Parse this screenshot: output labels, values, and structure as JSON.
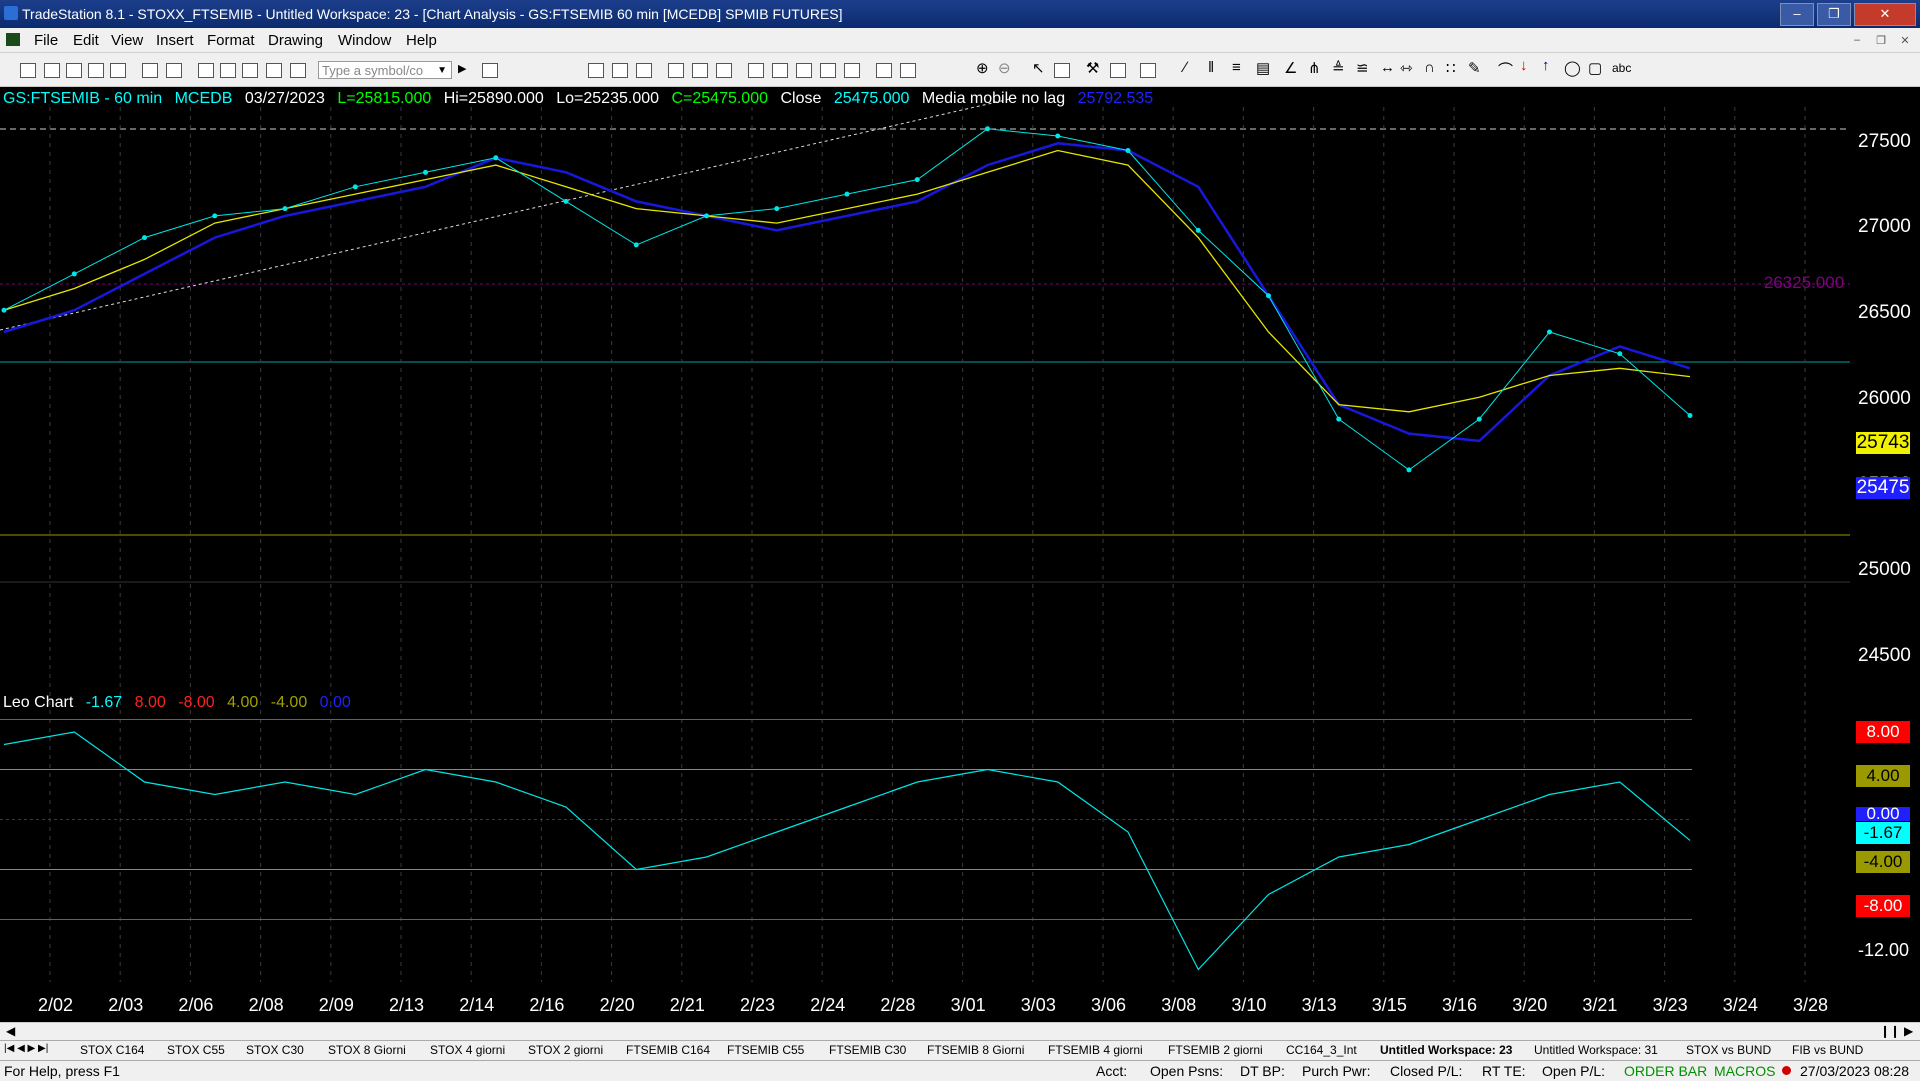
{
  "window": {
    "title": "TradeStation 8.1 - STOXX_FTSEMIB - Untitled Workspace:  23 - [Chart Analysis - GS:FTSEMIB  60 min  [MCEDB] SPMIB FUTURES]"
  },
  "menu": [
    "File",
    "Edit",
    "View",
    "Insert",
    "Format",
    "Drawing",
    "Window",
    "Help"
  ],
  "symbol_input": {
    "placeholder": "Type a symbol/co"
  },
  "chart_header": {
    "symbol": "GS:FTSEMIB - 60 min",
    "exchange": "MCEDB",
    "date": "03/27/2023",
    "last": "L=25815.000",
    "high": "Hi=25890.000",
    "low": "Lo=25235.000",
    "close_eq": "C=25475.000",
    "close_label": "Close",
    "close_value": "25475.000",
    "ma_name": "Media mobile no lag",
    "ma_value": "25792.535"
  },
  "indicator_header": {
    "name": "Leo Chart",
    "values": [
      "-1.67",
      "8.00",
      "-8.00",
      "4.00",
      "-4.00",
      "0.00"
    ],
    "colors": [
      "#00ffff",
      "#ff2020",
      "#ff2020",
      "#a0a000",
      "#a0a000",
      "#2020ff"
    ]
  },
  "colors": {
    "price": "#00e6e6",
    "blue_ma": "#1818dd",
    "yellow_ma": "#e6e600",
    "level_line": "#800080",
    "upper": "#ff2020",
    "mid": "#9a9a00",
    "zero": "#2020ff"
  },
  "price_axis": [
    "27500",
    "27000",
    "26500",
    "26000",
    "25500",
    "25000",
    "24500"
  ],
  "price_boxes": [
    {
      "value": "26325.000",
      "kind": "level"
    },
    {
      "value": "25743",
      "kind": "yellow"
    },
    {
      "value": "25475",
      "kind": "blue"
    }
  ],
  "indicator_axis": [
    "8.00",
    "4.00",
    "0.00",
    "-1.67",
    "-4.00",
    "-8.00",
    "-12.00"
  ],
  "dates": [
    "2/02",
    "2/03",
    "2/06",
    "2/08",
    "2/09",
    "2/13",
    "2/14",
    "2/16",
    "2/20",
    "2/21",
    "2/23",
    "2/24",
    "2/28",
    "3/01",
    "3/03",
    "3/06",
    "3/08",
    "3/10",
    "3/13",
    "3/15",
    "3/16",
    "3/20",
    "3/21",
    "3/23",
    "3/24",
    "3/28"
  ],
  "chart_data": {
    "type": "line",
    "title": "GS:FTSEMIB - 60 min",
    "ylim": [
      24500,
      27600
    ],
    "x": [
      "2/02",
      "2/03",
      "2/06",
      "2/08",
      "2/09",
      "2/13",
      "2/14",
      "2/16",
      "2/20",
      "2/21",
      "2/23",
      "2/24",
      "2/28",
      "3/01",
      "3/03",
      "3/06",
      "3/08",
      "3/10",
      "3/13",
      "3/15",
      "3/16",
      "3/20",
      "3/21",
      "3/23",
      "3/27"
    ],
    "series": [
      {
        "name": "Close",
        "values": [
          26200,
          26450,
          26700,
          26850,
          26900,
          27050,
          27150,
          27250,
          26950,
          26650,
          26850,
          26900,
          27000,
          27100,
          27450,
          27400,
          27300,
          26750,
          26300,
          25450,
          25100,
          25450,
          26050,
          25900,
          25475
        ]
      },
      {
        "values": [
          26050,
          26200,
          26450,
          26700,
          26850,
          26950,
          27050,
          27250,
          27150,
          26950,
          26850,
          26750,
          26850,
          26950,
          27200,
          27350,
          27300,
          27050,
          26300,
          25550,
          25350,
          25300,
          25750,
          25950,
          25800
        ]
      },
      {
        "values": [
          26200,
          26350,
          26550,
          26800,
          26900,
          27000,
          27100,
          27200,
          27050,
          26900,
          26850,
          26800,
          26900,
          27000,
          27150,
          27300,
          27200,
          26700,
          26050,
          25550,
          25500,
          25600,
          25750,
          25800,
          25743
        ]
      }
    ],
    "indicator": {
      "name": "Leo Chart",
      "ylim": [
        -13,
        9
      ],
      "levels": [
        8,
        4,
        0,
        -4,
        -8
      ],
      "values": [
        6,
        7,
        3,
        2,
        3,
        2,
        4,
        3,
        1,
        -4,
        -3,
        -1,
        1,
        3,
        4,
        3,
        -1,
        -12,
        -6,
        -3,
        -2,
        0,
        2,
        3,
        -1.67
      ]
    }
  },
  "workspace_tabs": [
    "STOX C164",
    "STOX C55",
    "STOX  C30",
    "STOX  8 Giorni",
    "STOX 4 giorni",
    "STOX  2 giorni",
    "FTSEMIB C164",
    "FTSEMIB C55",
    "FTSEMIB C30",
    "FTSEMIB  8 Giorni",
    "FTSEMIB  4 giorni",
    "FTSEMIB  2 giorni",
    "CC164_3_Int",
    "Untitled Workspace:  23",
    "Untitled Workspace:  31",
    "STOX vs BUND",
    "FIB vs BUND"
  ],
  "status": {
    "help": "For Help, press F1",
    "fields": [
      "Acct:",
      "Open Psns:",
      "DT BP:",
      "Purch Pwr:",
      "Closed P/L:",
      "RT TE:",
      "Open P/L:"
    ],
    "order_bar": "ORDER BAR",
    "macros": "MACROS",
    "datetime": "27/03/2023 08:28"
  }
}
